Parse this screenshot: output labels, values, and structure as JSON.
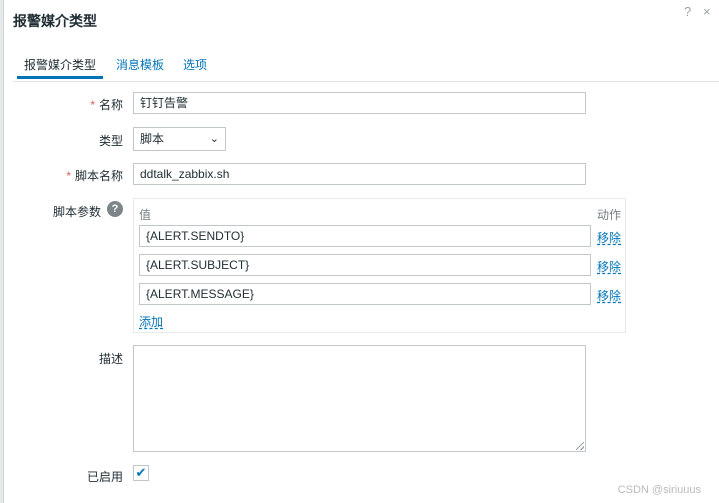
{
  "dialog": {
    "title": "报警媒介类型",
    "help_icon": "?",
    "close_icon": "×"
  },
  "tabs": [
    {
      "label": "报警媒介类型",
      "active": true
    },
    {
      "label": "消息模板",
      "active": false
    },
    {
      "label": "选项",
      "active": false
    }
  ],
  "form": {
    "name": {
      "label": "名称",
      "value": "钉钉告警",
      "required": true
    },
    "type": {
      "label": "类型",
      "value": "脚本"
    },
    "script_name": {
      "label": "脚本名称",
      "value": "ddtalk_zabbix.sh",
      "required": true
    },
    "script_params": {
      "label": "脚本参数",
      "col_value": "值",
      "col_action": "动作",
      "rows": [
        {
          "value": "{ALERT.SENDTO}",
          "action": "移除"
        },
        {
          "value": "{ALERT.SUBJECT}",
          "action": "移除"
        },
        {
          "value": "{ALERT.MESSAGE}",
          "action": "移除"
        }
      ],
      "add_label": "添加"
    },
    "description": {
      "label": "描述",
      "value": ""
    },
    "enabled": {
      "label": "已启用",
      "checked": true
    }
  },
  "watermark": "CSDN @siriuuus",
  "colors": {
    "accent": "#0275b8",
    "required": "#e45959",
    "text": "#1f2c33"
  }
}
